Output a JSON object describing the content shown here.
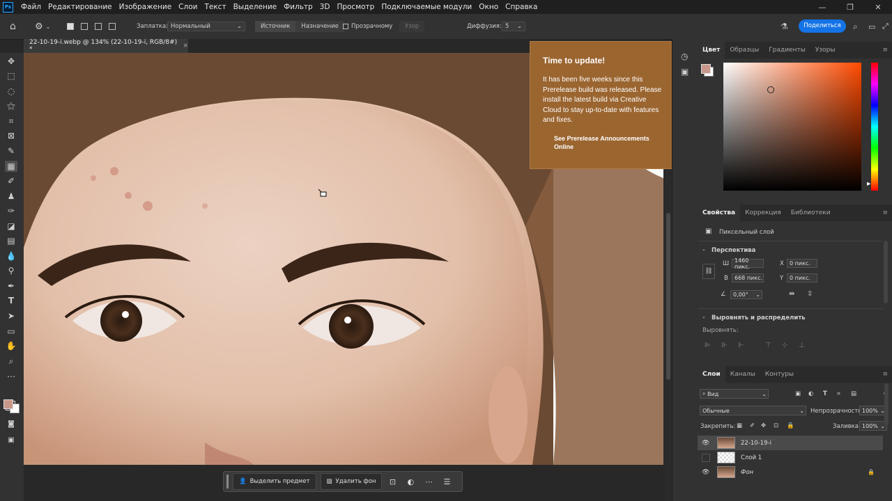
{
  "menubar": {
    "app_badge": "Ps",
    "items": [
      "Файл",
      "Редактирование",
      "Изображение",
      "Слои",
      "Текст",
      "Выделение",
      "Фильтр",
      "3D",
      "Просмотр",
      "Подключаемые модули",
      "Окно",
      "Справка"
    ]
  },
  "options": {
    "patch_label": "Заплатка:",
    "patch_mode": "Нормальный",
    "source_label": "Источник",
    "dest_label": "Назначение",
    "transparent_label": "Прозрачному",
    "pattern_label": "Узор",
    "diffusion_label": "Диффузия:",
    "diffusion_value": "5",
    "share_label": "Поделиться"
  },
  "document": {
    "tab_title": "22-10-19-i.webp @ 134% (22-10-19-i, RGB/8#) *"
  },
  "update_popup": {
    "title": "Time to update!",
    "body": "It has been five weeks since this Prerelease build was released. Please install the latest build via Creative Cloud to stay up-to-date with features and fixes.",
    "link": "See Prerelease Announcements Online"
  },
  "context_bar": {
    "select_subject": "Выделить предмет",
    "remove_bg": "Удалить фон"
  },
  "color_panel": {
    "tabs": [
      "Цвет",
      "Образцы",
      "Градиенты",
      "Узоры"
    ],
    "foreground": "#c9988a",
    "background": "#ffffff",
    "hue_color": "#ff4a00"
  },
  "properties": {
    "tabs": [
      "Свойства",
      "Коррекция",
      "Библиотеки"
    ],
    "layer_type": "Пиксельный слой",
    "section_transform": "Перспектива",
    "w_label": "Ш",
    "w_value": "1460 пикс.",
    "h_label": "В",
    "h_value": "668 пикс.",
    "x_label": "X",
    "x_value": "0 пикс.",
    "y_label": "Y",
    "y_value": "0 пикс.",
    "angle_value": "0,00°",
    "section_align": "Выровнять и распределить",
    "align_label": "Выровнять:"
  },
  "layers_panel": {
    "tabs": [
      "Слои",
      "Каналы",
      "Контуры"
    ],
    "filter_label": "Вид",
    "blend_mode": "Обычные",
    "opacity_label": "Непрозрачность:",
    "opacity_value": "100%",
    "lock_label": "Закрепить:",
    "fill_label": "Заливка:",
    "fill_value": "100%",
    "layers": [
      {
        "name": "22-10-19-i",
        "visible": true,
        "selected": true
      },
      {
        "name": "Слой 1",
        "visible": false,
        "selected": false
      },
      {
        "name": "Фон",
        "visible": true,
        "selected": false,
        "locked": true
      }
    ]
  }
}
